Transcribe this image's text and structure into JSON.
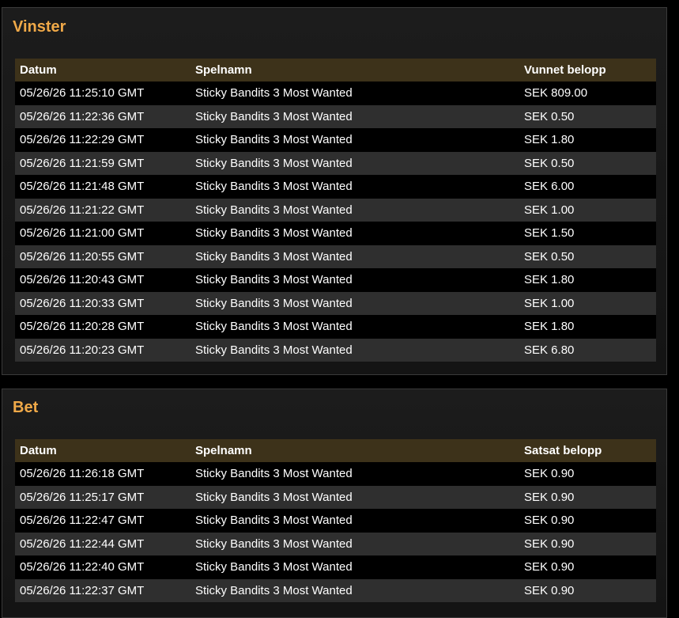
{
  "wins": {
    "title": "Vinster",
    "columns": [
      "Datum",
      "Spelnamn",
      "Vunnet belopp"
    ],
    "rows": [
      {
        "date": "05/26/26 11:25:10 GMT",
        "game": "Sticky Bandits 3 Most Wanted",
        "amount": "SEK 809.00"
      },
      {
        "date": "05/26/26 11:22:36 GMT",
        "game": "Sticky Bandits 3 Most Wanted",
        "amount": "SEK 0.50"
      },
      {
        "date": "05/26/26 11:22:29 GMT",
        "game": "Sticky Bandits 3 Most Wanted",
        "amount": "SEK 1.80"
      },
      {
        "date": "05/26/26 11:21:59 GMT",
        "game": "Sticky Bandits 3 Most Wanted",
        "amount": "SEK 0.50"
      },
      {
        "date": "05/26/26 11:21:48 GMT",
        "game": "Sticky Bandits 3 Most Wanted",
        "amount": "SEK 6.00"
      },
      {
        "date": "05/26/26 11:21:22 GMT",
        "game": "Sticky Bandits 3 Most Wanted",
        "amount": "SEK 1.00"
      },
      {
        "date": "05/26/26 11:21:00 GMT",
        "game": "Sticky Bandits 3 Most Wanted",
        "amount": "SEK 1.50"
      },
      {
        "date": "05/26/26 11:20:55 GMT",
        "game": "Sticky Bandits 3 Most Wanted",
        "amount": "SEK 0.50"
      },
      {
        "date": "05/26/26 11:20:43 GMT",
        "game": "Sticky Bandits 3 Most Wanted",
        "amount": "SEK 1.80"
      },
      {
        "date": "05/26/26 11:20:33 GMT",
        "game": "Sticky Bandits 3 Most Wanted",
        "amount": "SEK 1.00"
      },
      {
        "date": "05/26/26 11:20:28 GMT",
        "game": "Sticky Bandits 3 Most Wanted",
        "amount": "SEK 1.80"
      },
      {
        "date": "05/26/26 11:20:23 GMT",
        "game": "Sticky Bandits 3 Most Wanted",
        "amount": "SEK 6.80"
      }
    ]
  },
  "bets": {
    "title": "Bet",
    "columns": [
      "Datum",
      "Spelnamn",
      "Satsat belopp"
    ],
    "rows": [
      {
        "date": "05/26/26 11:26:18 GMT",
        "game": "Sticky Bandits 3 Most Wanted",
        "amount": "SEK 0.90"
      },
      {
        "date": "05/26/26 11:25:17 GMT",
        "game": "Sticky Bandits 3 Most Wanted",
        "amount": "SEK 0.90"
      },
      {
        "date": "05/26/26 11:22:47 GMT",
        "game": "Sticky Bandits 3 Most Wanted",
        "amount": "SEK 0.90"
      },
      {
        "date": "05/26/26 11:22:44 GMT",
        "game": "Sticky Bandits 3 Most Wanted",
        "amount": "SEK 0.90"
      },
      {
        "date": "05/26/26 11:22:40 GMT",
        "game": "Sticky Bandits 3 Most Wanted",
        "amount": "SEK 0.90"
      },
      {
        "date": "05/26/26 11:22:37 GMT",
        "game": "Sticky Bandits 3 Most Wanted",
        "amount": "SEK 0.90"
      }
    ]
  },
  "colors": {
    "title": "#f0a948",
    "header_bg": "#3d321a",
    "row_alt": "#2f2f2f",
    "row_base": "#000000",
    "panel_bg": "#1a1a1a"
  }
}
